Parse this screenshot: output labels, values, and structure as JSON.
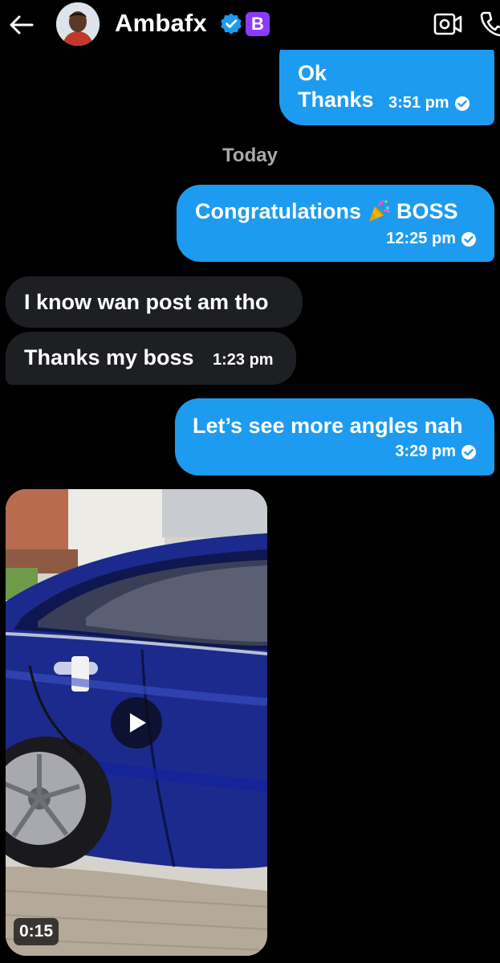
{
  "header": {
    "contact_name": "Ambafx",
    "premium_badge": "B",
    "icons": [
      "back-arrow-icon",
      "verified-badge-icon",
      "video-call-icon",
      "phone-call-icon"
    ]
  },
  "messages": {
    "m1": {
      "direction": "out",
      "text_top": "Ok",
      "text": "Thanks",
      "time": "3:51 pm",
      "read": true
    },
    "day_separator": "Today",
    "m2": {
      "direction": "out",
      "text_before_emoji": "Congratulations",
      "emoji": "🎉",
      "text_after_emoji": "BOSS",
      "time": "12:25 pm",
      "read": true
    },
    "m3": {
      "direction": "in",
      "text": "I know wan post am tho"
    },
    "m4": {
      "direction": "in",
      "text": "Thanks my boss",
      "time": "1:23 pm"
    },
    "m5": {
      "direction": "out",
      "text": "Let’s see more angles nah",
      "time": "3:29 pm",
      "read": true
    },
    "m6": {
      "direction": "in",
      "type": "video",
      "duration": "0:15"
    }
  },
  "colors": {
    "background": "#000000",
    "outgoing_bubble": "#1d9bf0",
    "incoming_bubble": "#1e1f22",
    "premium_badge": "#8b3bff",
    "verified_badge": "#1d9bf0"
  }
}
